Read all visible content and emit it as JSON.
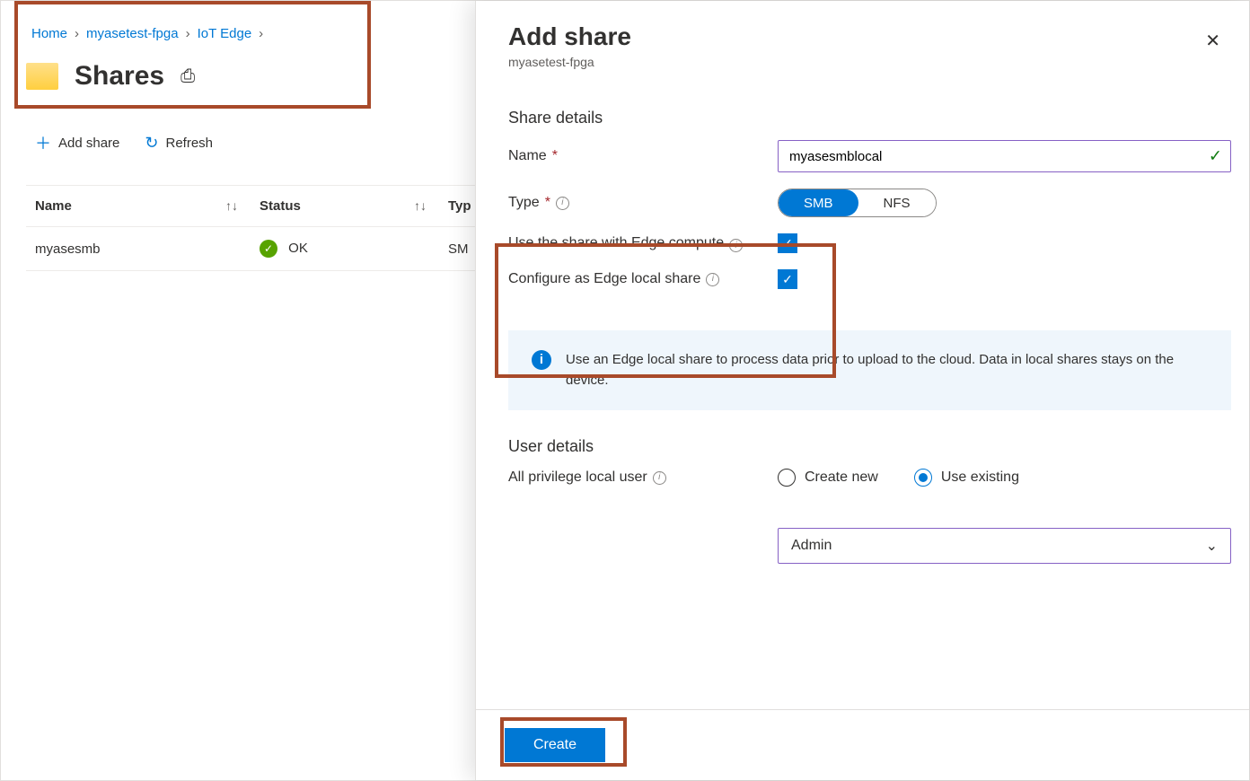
{
  "breadcrumb": {
    "home": "Home",
    "device": "myasetest-fpga",
    "section": "IoT Edge"
  },
  "page": {
    "title": "Shares"
  },
  "toolbar": {
    "add": "Add share",
    "refresh": "Refresh"
  },
  "table": {
    "headers": {
      "name": "Name",
      "status": "Status",
      "type": "Typ"
    },
    "rows": [
      {
        "name": "myasesmb",
        "status": "OK",
        "type": "SM"
      }
    ]
  },
  "panel": {
    "title": "Add share",
    "subtitle": "myasetest-fpga",
    "share_details_heading": "Share details",
    "name_label": "Name",
    "name_value": "myasesmblocal",
    "type_label": "Type",
    "type_options": {
      "smb": "SMB",
      "nfs": "NFS"
    },
    "edge_compute_label": "Use the share with Edge compute",
    "edge_local_label": "Configure as Edge local share",
    "info_text": "Use an Edge local share to process data prior to upload to the cloud. Data in local shares stays on the device.",
    "user_details_heading": "User details",
    "user_label": "All privilege local user",
    "user_options": {
      "create": "Create new",
      "existing": "Use existing"
    },
    "user_select": "Admin",
    "create_btn": "Create"
  }
}
